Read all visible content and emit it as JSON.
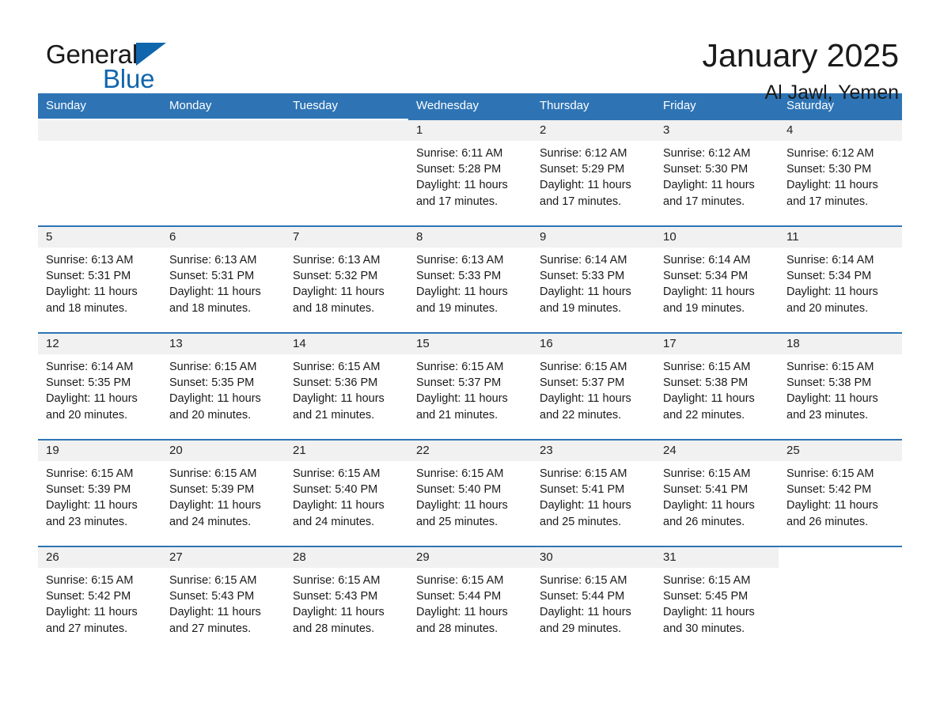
{
  "brand": {
    "word1": "General",
    "word2": "Blue",
    "flag_icon": "triangle-flag-icon",
    "accent_color": "#1066ad"
  },
  "header": {
    "title": "January 2025",
    "location": "Al Jawl, Yemen"
  },
  "theme": {
    "header_blue": "#2e74b5",
    "daynum_strip_gray": "#f1f1f1",
    "text": "#1a1a1a"
  },
  "calendar": {
    "weekday_headers": [
      "Sunday",
      "Monday",
      "Tuesday",
      "Wednesday",
      "Thursday",
      "Friday",
      "Saturday"
    ],
    "weeks": [
      [
        {
          "day": "",
          "blank": true
        },
        {
          "day": "",
          "blank": true
        },
        {
          "day": "",
          "blank": true
        },
        {
          "day": "1",
          "sunrise": "Sunrise: 6:11 AM",
          "sunset": "Sunset: 5:28 PM",
          "daylight": "Daylight: 11 hours and 17 minutes."
        },
        {
          "day": "2",
          "sunrise": "Sunrise: 6:12 AM",
          "sunset": "Sunset: 5:29 PM",
          "daylight": "Daylight: 11 hours and 17 minutes."
        },
        {
          "day": "3",
          "sunrise": "Sunrise: 6:12 AM",
          "sunset": "Sunset: 5:30 PM",
          "daylight": "Daylight: 11 hours and 17 minutes."
        },
        {
          "day": "4",
          "sunrise": "Sunrise: 6:12 AM",
          "sunset": "Sunset: 5:30 PM",
          "daylight": "Daylight: 11 hours and 17 minutes."
        }
      ],
      [
        {
          "day": "5",
          "sunrise": "Sunrise: 6:13 AM",
          "sunset": "Sunset: 5:31 PM",
          "daylight": "Daylight: 11 hours and 18 minutes."
        },
        {
          "day": "6",
          "sunrise": "Sunrise: 6:13 AM",
          "sunset": "Sunset: 5:31 PM",
          "daylight": "Daylight: 11 hours and 18 minutes."
        },
        {
          "day": "7",
          "sunrise": "Sunrise: 6:13 AM",
          "sunset": "Sunset: 5:32 PM",
          "daylight": "Daylight: 11 hours and 18 minutes."
        },
        {
          "day": "8",
          "sunrise": "Sunrise: 6:13 AM",
          "sunset": "Sunset: 5:33 PM",
          "daylight": "Daylight: 11 hours and 19 minutes."
        },
        {
          "day": "9",
          "sunrise": "Sunrise: 6:14 AM",
          "sunset": "Sunset: 5:33 PM",
          "daylight": "Daylight: 11 hours and 19 minutes."
        },
        {
          "day": "10",
          "sunrise": "Sunrise: 6:14 AM",
          "sunset": "Sunset: 5:34 PM",
          "daylight": "Daylight: 11 hours and 19 minutes."
        },
        {
          "day": "11",
          "sunrise": "Sunrise: 6:14 AM",
          "sunset": "Sunset: 5:34 PM",
          "daylight": "Daylight: 11 hours and 20 minutes."
        }
      ],
      [
        {
          "day": "12",
          "sunrise": "Sunrise: 6:14 AM",
          "sunset": "Sunset: 5:35 PM",
          "daylight": "Daylight: 11 hours and 20 minutes."
        },
        {
          "day": "13",
          "sunrise": "Sunrise: 6:15 AM",
          "sunset": "Sunset: 5:35 PM",
          "daylight": "Daylight: 11 hours and 20 minutes."
        },
        {
          "day": "14",
          "sunrise": "Sunrise: 6:15 AM",
          "sunset": "Sunset: 5:36 PM",
          "daylight": "Daylight: 11 hours and 21 minutes."
        },
        {
          "day": "15",
          "sunrise": "Sunrise: 6:15 AM",
          "sunset": "Sunset: 5:37 PM",
          "daylight": "Daylight: 11 hours and 21 minutes."
        },
        {
          "day": "16",
          "sunrise": "Sunrise: 6:15 AM",
          "sunset": "Sunset: 5:37 PM",
          "daylight": "Daylight: 11 hours and 22 minutes."
        },
        {
          "day": "17",
          "sunrise": "Sunrise: 6:15 AM",
          "sunset": "Sunset: 5:38 PM",
          "daylight": "Daylight: 11 hours and 22 minutes."
        },
        {
          "day": "18",
          "sunrise": "Sunrise: 6:15 AM",
          "sunset": "Sunset: 5:38 PM",
          "daylight": "Daylight: 11 hours and 23 minutes."
        }
      ],
      [
        {
          "day": "19",
          "sunrise": "Sunrise: 6:15 AM",
          "sunset": "Sunset: 5:39 PM",
          "daylight": "Daylight: 11 hours and 23 minutes."
        },
        {
          "day": "20",
          "sunrise": "Sunrise: 6:15 AM",
          "sunset": "Sunset: 5:39 PM",
          "daylight": "Daylight: 11 hours and 24 minutes."
        },
        {
          "day": "21",
          "sunrise": "Sunrise: 6:15 AM",
          "sunset": "Sunset: 5:40 PM",
          "daylight": "Daylight: 11 hours and 24 minutes."
        },
        {
          "day": "22",
          "sunrise": "Sunrise: 6:15 AM",
          "sunset": "Sunset: 5:40 PM",
          "daylight": "Daylight: 11 hours and 25 minutes."
        },
        {
          "day": "23",
          "sunrise": "Sunrise: 6:15 AM",
          "sunset": "Sunset: 5:41 PM",
          "daylight": "Daylight: 11 hours and 25 minutes."
        },
        {
          "day": "24",
          "sunrise": "Sunrise: 6:15 AM",
          "sunset": "Sunset: 5:41 PM",
          "daylight": "Daylight: 11 hours and 26 minutes."
        },
        {
          "day": "25",
          "sunrise": "Sunrise: 6:15 AM",
          "sunset": "Sunset: 5:42 PM",
          "daylight": "Daylight: 11 hours and 26 minutes."
        }
      ],
      [
        {
          "day": "26",
          "sunrise": "Sunrise: 6:15 AM",
          "sunset": "Sunset: 5:42 PM",
          "daylight": "Daylight: 11 hours and 27 minutes."
        },
        {
          "day": "27",
          "sunrise": "Sunrise: 6:15 AM",
          "sunset": "Sunset: 5:43 PM",
          "daylight": "Daylight: 11 hours and 27 minutes."
        },
        {
          "day": "28",
          "sunrise": "Sunrise: 6:15 AM",
          "sunset": "Sunset: 5:43 PM",
          "daylight": "Daylight: 11 hours and 28 minutes."
        },
        {
          "day": "29",
          "sunrise": "Sunrise: 6:15 AM",
          "sunset": "Sunset: 5:44 PM",
          "daylight": "Daylight: 11 hours and 28 minutes."
        },
        {
          "day": "30",
          "sunrise": "Sunrise: 6:15 AM",
          "sunset": "Sunset: 5:44 PM",
          "daylight": "Daylight: 11 hours and 29 minutes."
        },
        {
          "day": "31",
          "sunrise": "Sunrise: 6:15 AM",
          "sunset": "Sunset: 5:45 PM",
          "daylight": "Daylight: 11 hours and 30 minutes."
        },
        {
          "day": "",
          "blank": true,
          "trailing": true
        }
      ]
    ]
  }
}
